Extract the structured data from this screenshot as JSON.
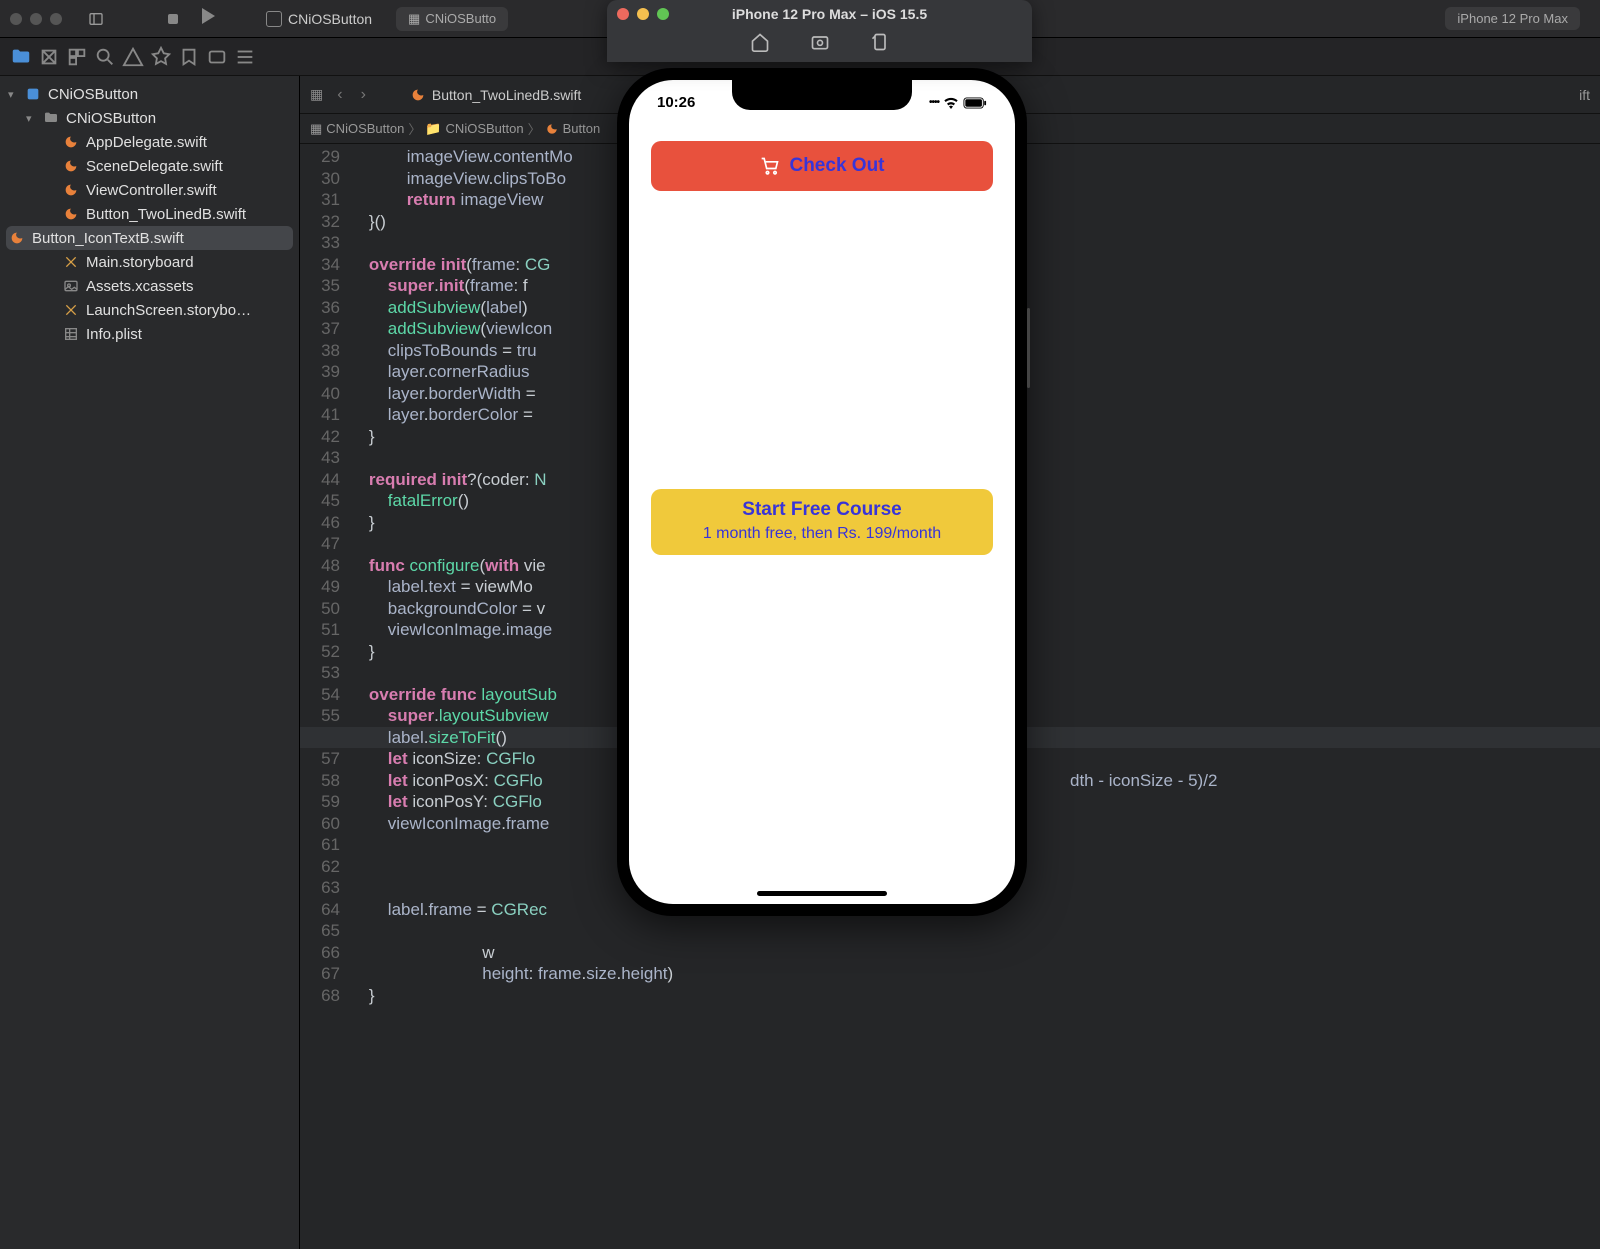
{
  "toolbar": {
    "project_name": "CNiOSButton",
    "sub_project": "CNiOSButto",
    "device_label": "iPhone 12 Pro Max"
  },
  "tab": {
    "filename": "Button_TwoLinedB.swift",
    "right_file": "ift"
  },
  "breadcrumb": {
    "p1": "CNiOSButton",
    "p2": "CNiOSButton",
    "p3": "Button"
  },
  "sidebar": {
    "root": "CNiOSButton",
    "folder": "CNiOSButton",
    "files": [
      "AppDelegate.swift",
      "SceneDelegate.swift",
      "ViewController.swift",
      "Button_TwoLinedB.swift",
      "Button_IconTextB.swift",
      "Main.storyboard",
      "Assets.xcassets",
      "LaunchScreen.storybo…",
      "Info.plist"
    ]
  },
  "code": {
    "start": 29,
    "lines": [
      "            imageView.contentMo",
      "            imageView.clipsToBo",
      "            return imageView",
      "    }()",
      "",
      "    override init(frame: CG",
      "        super.init(frame: f",
      "        addSubview(label)",
      "        addSubview(viewIcon",
      "        clipsToBounds = tru",
      "        layer.cornerRadius ",
      "        layer.borderWidth =",
      "        layer.borderColor =",
      "    }",
      "",
      "    required init?(coder: N",
      "        fatalError()",
      "    }",
      "",
      "    func configure(with vie",
      "        label.text = viewMo",
      "        backgroundColor = v",
      "        viewIconImage.image",
      "    }",
      "",
      "    override func layoutSub",
      "        super.layoutSubview",
      "        label.sizeToFit()",
      "        let iconSize: CGFlo",
      "        let iconPosX: CGFlo",
      "        let iconPosY: CGFlo",
      "        viewIconImage.frame",
      "",
      "",
      "",
      "        label.frame = CGRec",
      "",
      "                            w",
      "                            height: frame.size.height)",
      "    }"
    ],
    "tail_58": "dth - iconSize - 5)/2"
  },
  "simulator": {
    "title": "iPhone 12 Pro Max – iOS 15.5",
    "status_time": "10:26"
  },
  "phone": {
    "checkout_label": "Check Out",
    "course_title": "Start Free Course",
    "course_sub": "1 month free, then Rs. 199/month"
  }
}
